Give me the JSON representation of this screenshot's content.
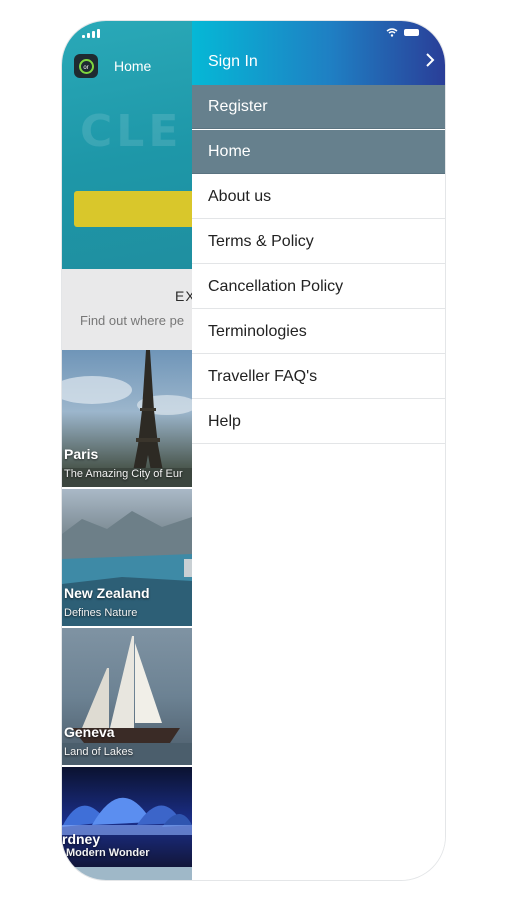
{
  "app": {
    "title": "Home",
    "logo_text": "or",
    "explore_title": "EX",
    "explore_subtitle": "Find out where pe",
    "destinations": [
      {
        "name": "Paris",
        "tagline": "The Amazing City of Eur"
      },
      {
        "name": "New Zealand",
        "tagline": "Defines Nature"
      },
      {
        "name": "Geneva",
        "tagline": "Land of Lakes"
      },
      {
        "name": "rdney",
        "tagline": "Modern Wonder"
      }
    ]
  },
  "drawer": {
    "header_label": "Sign In",
    "items": [
      {
        "label": "Register"
      },
      {
        "label": "Home"
      },
      {
        "label": "About us"
      },
      {
        "label": "Terms & Policy"
      },
      {
        "label": "Cancellation Policy"
      },
      {
        "label": "Terminologies"
      },
      {
        "label": "Traveller FAQ's"
      },
      {
        "label": "Help"
      }
    ]
  },
  "icons": [
    "signal-icon",
    "wifi-icon",
    "battery-icon",
    "chevron-right-icon",
    "app-logo-icon"
  ],
  "colors": {
    "header_gradient_start": "#05b8d6",
    "header_gradient_end": "#2a3e98",
    "active_item_bg": "#66808d",
    "hero_bg": "#1e97a8",
    "search_button": "#d9c72b"
  }
}
